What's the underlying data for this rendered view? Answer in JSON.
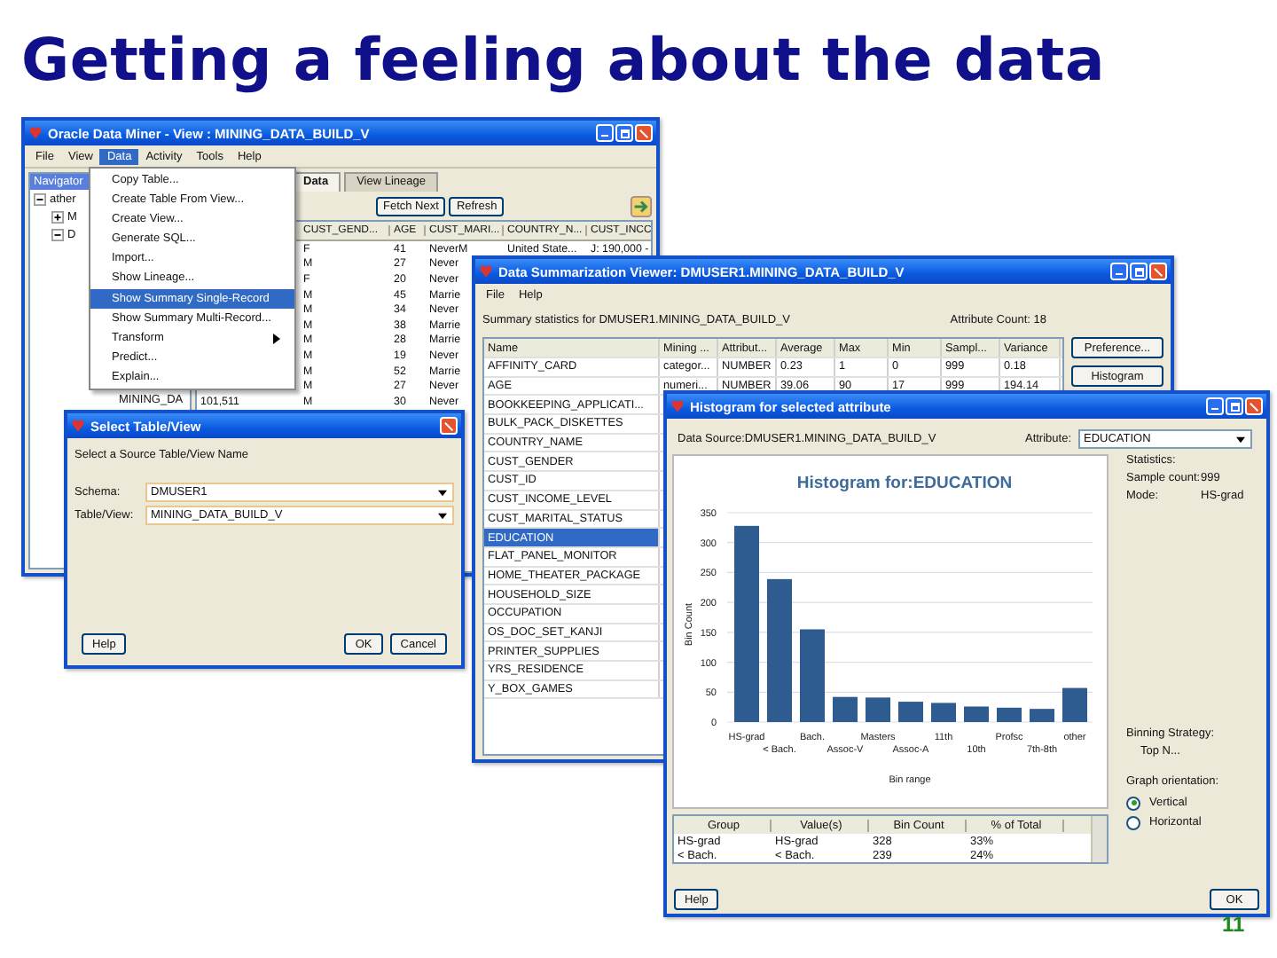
{
  "slide": {
    "title": "Getting a feeling about the data",
    "page_number": "11"
  },
  "main_window": {
    "title": "Oracle Data Miner - View : MINING_DATA_BUILD_V",
    "menus": [
      {
        "label": "File",
        "selected": false
      },
      {
        "label": "View",
        "selected": false
      },
      {
        "label": "Data",
        "selected": true
      },
      {
        "label": "Activity",
        "selected": false
      },
      {
        "label": "Tools",
        "selected": false
      },
      {
        "label": "Help",
        "selected": false
      }
    ],
    "menu_items": [
      {
        "label": "Copy Table...",
        "kind": "item",
        "selected": false
      },
      {
        "label": "Create Table From View...",
        "kind": "item",
        "selected": false
      },
      {
        "label": "Create View...",
        "kind": "item",
        "selected": false
      },
      {
        "label": "Generate SQL...",
        "kind": "item",
        "selected": false
      },
      {
        "label": "Import...",
        "kind": "item",
        "selected": false
      },
      {
        "label": "Show Lineage...",
        "kind": "item",
        "selected": false
      },
      {
        "label": "Show Summary Single-Record",
        "kind": "item",
        "selected": true
      },
      {
        "label": "Show Summary Multi-Record...",
        "kind": "item",
        "selected": false
      },
      {
        "label": "Transform",
        "kind": "submenu",
        "selected": false
      },
      {
        "label": "Predict...",
        "kind": "item",
        "selected": false
      },
      {
        "label": "Explain...",
        "kind": "item",
        "selected": false
      }
    ],
    "navigator": {
      "title": "Navigator",
      "nodes": [
        {
          "label": "ather",
          "expanded": true,
          "children": [
            {
              "label": "M",
              "expanded": false
            },
            {
              "label": "D",
              "expanded": true,
              "children": [
                {
                  "label": "MINING_DA"
                }
              ]
            }
          ]
        }
      ]
    },
    "tabs": [
      {
        "label": "Data",
        "selected": true
      },
      {
        "label": "View Lineage",
        "selected": false
      }
    ],
    "buttons": [
      "Fetch Next",
      "Refresh"
    ],
    "table": {
      "columns": [
        "CUST_GEND...",
        "AGE",
        "CUST_MARI...",
        "COUNTRY_N...",
        "CUST_INCC"
      ],
      "rows": [
        {
          "cells": [
            "F",
            "41",
            "NeverM",
            "United State...",
            "J: 190,000 -"
          ]
        },
        {
          "cells": [
            "M",
            "27",
            "Never"
          ]
        },
        {
          "cells": [
            "F",
            "20",
            "Never"
          ]
        },
        {
          "cells": [
            "M",
            "45",
            "Marrie"
          ]
        },
        {
          "cells": [
            "M",
            "34",
            "Never"
          ]
        },
        {
          "cells": [
            "M",
            "38",
            "Marrie"
          ]
        },
        {
          "cells": [
            "M",
            "28",
            "Marrie"
          ]
        },
        {
          "cells": [
            "M",
            "19",
            "Never"
          ]
        },
        {
          "cells": [
            "M",
            "52",
            "Marrie"
          ]
        },
        {
          "cells": [
            "M",
            "27",
            "Never"
          ]
        },
        {
          "id": "101,511",
          "cells": [
            "M",
            "30",
            "Never"
          ]
        }
      ]
    }
  },
  "select_dialog": {
    "title": "Select Table/View",
    "prompt": "Select a Source Table/View Name",
    "fields": [
      {
        "label": "Schema:",
        "value": "DMUSER1"
      },
      {
        "label": "Table/View:",
        "value": "MINING_DATA_BUILD_V"
      }
    ],
    "help_button": "Help",
    "buttons": [
      "OK",
      "Cancel"
    ]
  },
  "summary_window": {
    "title": "Data Summarization Viewer: DMUSER1.MINING_DATA_BUILD_V",
    "menus": [
      "File",
      "Help"
    ],
    "caption": "Summary statistics for DMUSER1.MINING_DATA_BUILD_V",
    "attribute_count": "Attribute Count: 18",
    "buttons": [
      "Preference...",
      "Histogram"
    ],
    "table": {
      "columns": [
        "Name",
        "Mining ...",
        "Attribut...",
        "Average",
        "Max",
        "Min",
        "Sampl...",
        "Variance"
      ],
      "rows": [
        {
          "cells": [
            "AFFINITY_CARD",
            "categor...",
            "NUMBER",
            "0.23",
            "1",
            "0",
            "999",
            "0.18"
          ],
          "selected": false
        },
        {
          "cells": [
            "AGE",
            "numeri...",
            "NUMBER",
            "39.06",
            "90",
            "17",
            "999",
            "194.14"
          ],
          "selected": false
        },
        {
          "cells": [
            "BOOKKEEPING_APPLICATI..."
          ],
          "selected": false
        },
        {
          "cells": [
            "BULK_PACK_DISKETTES"
          ],
          "selected": false
        },
        {
          "cells": [
            "COUNTRY_NAME"
          ],
          "selected": false
        },
        {
          "cells": [
            "CUST_GENDER"
          ],
          "selected": false
        },
        {
          "cells": [
            "CUST_ID"
          ],
          "selected": false
        },
        {
          "cells": [
            "CUST_INCOME_LEVEL"
          ],
          "selected": false
        },
        {
          "cells": [
            "CUST_MARITAL_STATUS"
          ],
          "selected": false
        },
        {
          "cells": [
            "EDUCATION"
          ],
          "selected": true
        },
        {
          "cells": [
            "FLAT_PANEL_MONITOR"
          ],
          "selected": false
        },
        {
          "cells": [
            "HOME_THEATER_PACKAGE"
          ],
          "selected": false
        },
        {
          "cells": [
            "HOUSEHOLD_SIZE"
          ],
          "selected": false
        },
        {
          "cells": [
            "OCCUPATION"
          ],
          "selected": false
        },
        {
          "cells": [
            "OS_DOC_SET_KANJI"
          ],
          "selected": false
        },
        {
          "cells": [
            "PRINTER_SUPPLIES"
          ],
          "selected": false
        },
        {
          "cells": [
            "YRS_RESIDENCE"
          ],
          "selected": false
        },
        {
          "cells": [
            "Y_BOX_GAMES"
          ],
          "selected": false
        }
      ]
    }
  },
  "histogram_window": {
    "title": "Histogram for selected attribute",
    "data_source": "Data Source:DMUSER1.MINING_DATA_BUILD_V",
    "attribute_label": "Attribute:",
    "attribute_value": "EDUCATION",
    "chart_data": {
      "type": "bar",
      "title": "Histogram for:EDUCATION",
      "xlabel": "Bin range",
      "ylabel": "Bin Count",
      "categories": [
        "HS-grad",
        "< Bach.",
        "Bach.",
        "Assoc-V",
        "Masters",
        "Assoc-A",
        "11th",
        "10th",
        "Profsc",
        "7th-8th",
        "other"
      ],
      "values": [
        328,
        239,
        155,
        42,
        41,
        34,
        32,
        26,
        24,
        22,
        57
      ],
      "ylim": [
        0,
        350
      ],
      "grid": true,
      "yticks": [
        0,
        50,
        100,
        150,
        200,
        250,
        300,
        350
      ]
    },
    "statistics_label": "Statistics:",
    "stats": [
      {
        "label": "Sample count:",
        "value": "999"
      },
      {
        "label": "Mode:",
        "value": "HS-grad"
      }
    ],
    "binning_label": "Binning Strategy:",
    "binning_value": "Top N...",
    "orientation_label": "Graph orientation:",
    "orientations": [
      {
        "label": "Vertical",
        "selected": true
      },
      {
        "label": "Horizontal",
        "selected": false
      }
    ],
    "table": {
      "columns": [
        "Group",
        "Value(s)",
        "Bin Count",
        "% of Total"
      ],
      "rows": [
        {
          "cells": [
            "HS-grad",
            "HS-grad",
            "328",
            "33%"
          ]
        },
        {
          "cells": [
            "< Bach.",
            "< Bach.",
            "239",
            "24%"
          ]
        }
      ]
    },
    "help_button": "Help",
    "ok_button": "OK"
  }
}
